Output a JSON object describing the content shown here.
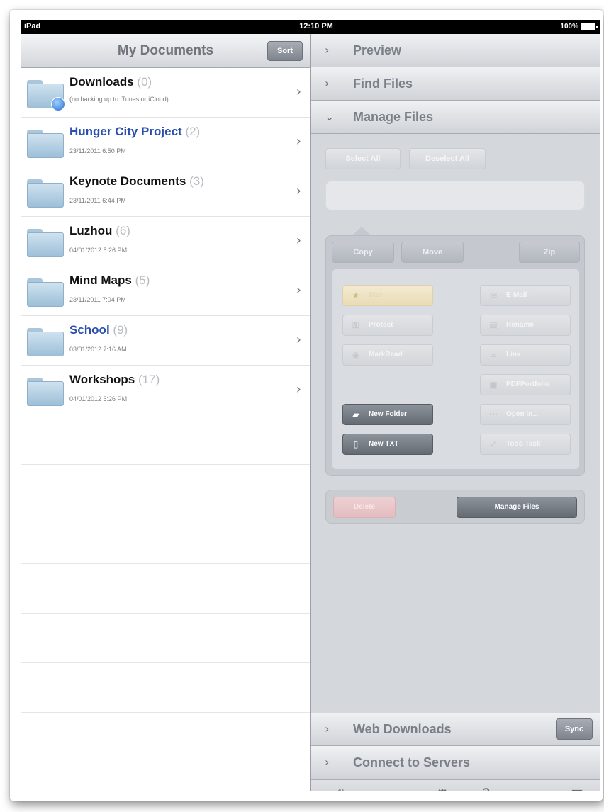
{
  "status_bar": {
    "carrier": "iPad",
    "time": "12:10 PM",
    "battery": "100%"
  },
  "left": {
    "title": "My Documents",
    "sort_label": "Sort",
    "items": [
      {
        "name": "Downloads",
        "count": "(0)",
        "sub": "(no backing up to iTunes or iCloud)",
        "color": "#111111"
      },
      {
        "name": "Hunger City Project",
        "count": "(2)",
        "sub": "23/11/2011 6:50 PM",
        "color": "#2b4fb0"
      },
      {
        "name": "Keynote Documents",
        "count": "(3)",
        "sub": "23/11/2011 6:44 PM",
        "color": "#111111"
      },
      {
        "name": "Luzhou",
        "count": "(6)",
        "sub": "04/01/2012 5:26 PM",
        "color": "#111111"
      },
      {
        "name": "Mind Maps",
        "count": "(5)",
        "sub": "23/11/2011 7:04 PM",
        "color": "#111111"
      },
      {
        "name": "School",
        "count": "(9)",
        "sub": "03/01/2012 7:16 AM",
        "color": "#2b4fb0"
      },
      {
        "name": "Workshops",
        "count": "(17)",
        "sub": "04/01/2012 5:26 PM",
        "color": "#111111"
      }
    ]
  },
  "right": {
    "sections": {
      "preview": "Preview",
      "find_files": "Find Files",
      "manage_files": "Manage Files",
      "web_downloads": "Web Downloads",
      "connect_servers": "Connect to Servers"
    },
    "select_all": "Select All",
    "deselect_all": "Deselect All",
    "copy": "Copy",
    "move": "Move",
    "zip": "Zip",
    "ops": {
      "star": "Star",
      "email": "E-Mail",
      "protect": "Protect",
      "rename": "Rename",
      "mark_read": "MarkRead",
      "link": "Link",
      "pdf_portfolio": "PDFPortfolio",
      "new_folder": "New Folder",
      "open_in": "Open In...",
      "new_txt": "New TXT",
      "todo_task": "Todo Task"
    },
    "delete": "Delete",
    "manage_files_button": "Manage Files",
    "sync": "Sync",
    "toolbar": {
      "help_glyph": "?"
    }
  }
}
